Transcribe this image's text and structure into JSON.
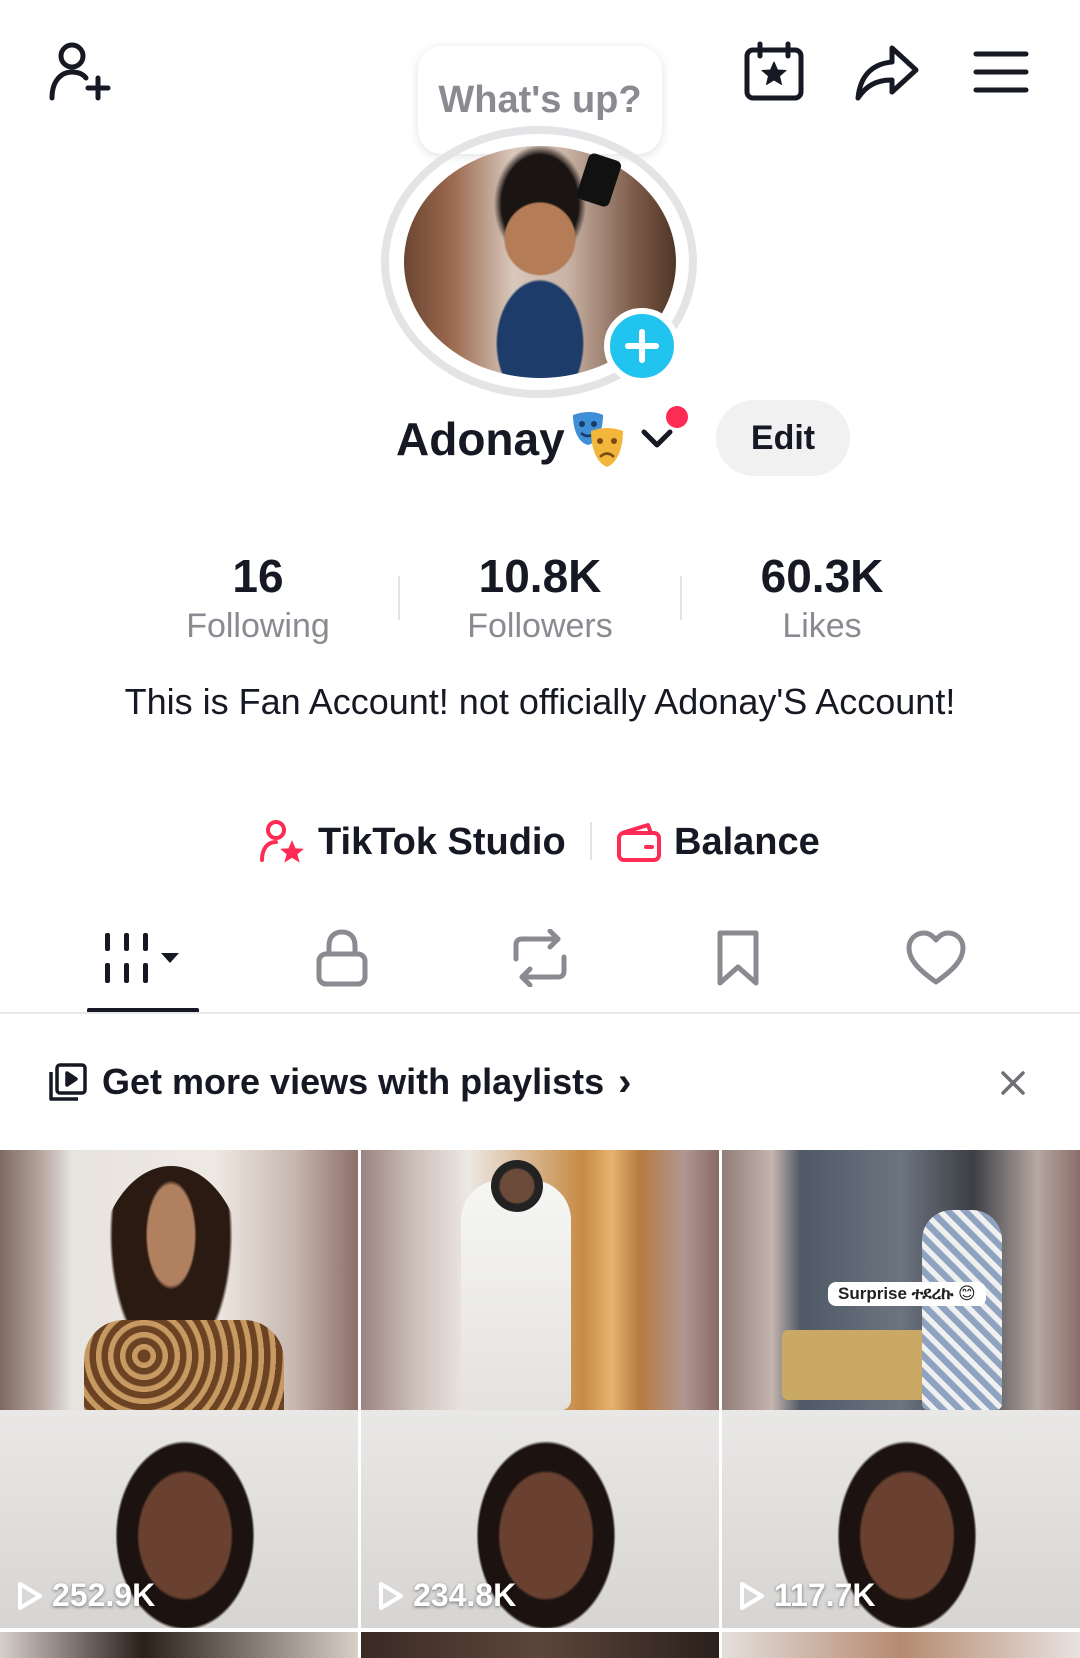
{
  "top_bar": {
    "add_friend_icon": "person-plus-icon",
    "calendar_icon": "calendar-star-icon",
    "share_icon": "share-arrow-icon",
    "menu_icon": "hamburger-menu-icon"
  },
  "status_bubble": "What's up?",
  "profile": {
    "name": "Adonay",
    "name_emoji": "🎭",
    "edit_label": "Edit",
    "accent_color": "#fe2c55",
    "plus_color": "#21c4ee"
  },
  "stats": [
    {
      "value": "16",
      "label": "Following"
    },
    {
      "value": "10.8K",
      "label": "Followers"
    },
    {
      "value": "60.3K",
      "label": "Likes"
    }
  ],
  "bio": "This is Fan Account! not officially Adonay'S Account!",
  "links": {
    "studio": "TikTok Studio",
    "balance": "Balance"
  },
  "tabs": [
    {
      "icon": "grid-videos-icon",
      "active": true
    },
    {
      "icon": "lock-icon",
      "active": false
    },
    {
      "icon": "repost-icon",
      "active": false
    },
    {
      "icon": "bookmark-icon",
      "active": false
    },
    {
      "icon": "heart-icon",
      "active": false
    }
  ],
  "playlist_banner": {
    "text": "Get more views with playlists",
    "chevron": "›",
    "close_icon": "close-icon"
  },
  "videos": [
    {
      "views": "252.9K"
    },
    {
      "views": "234.8K"
    },
    {
      "views": "117.7K",
      "caption": "Surprise ተደረኩ 😊"
    }
  ]
}
